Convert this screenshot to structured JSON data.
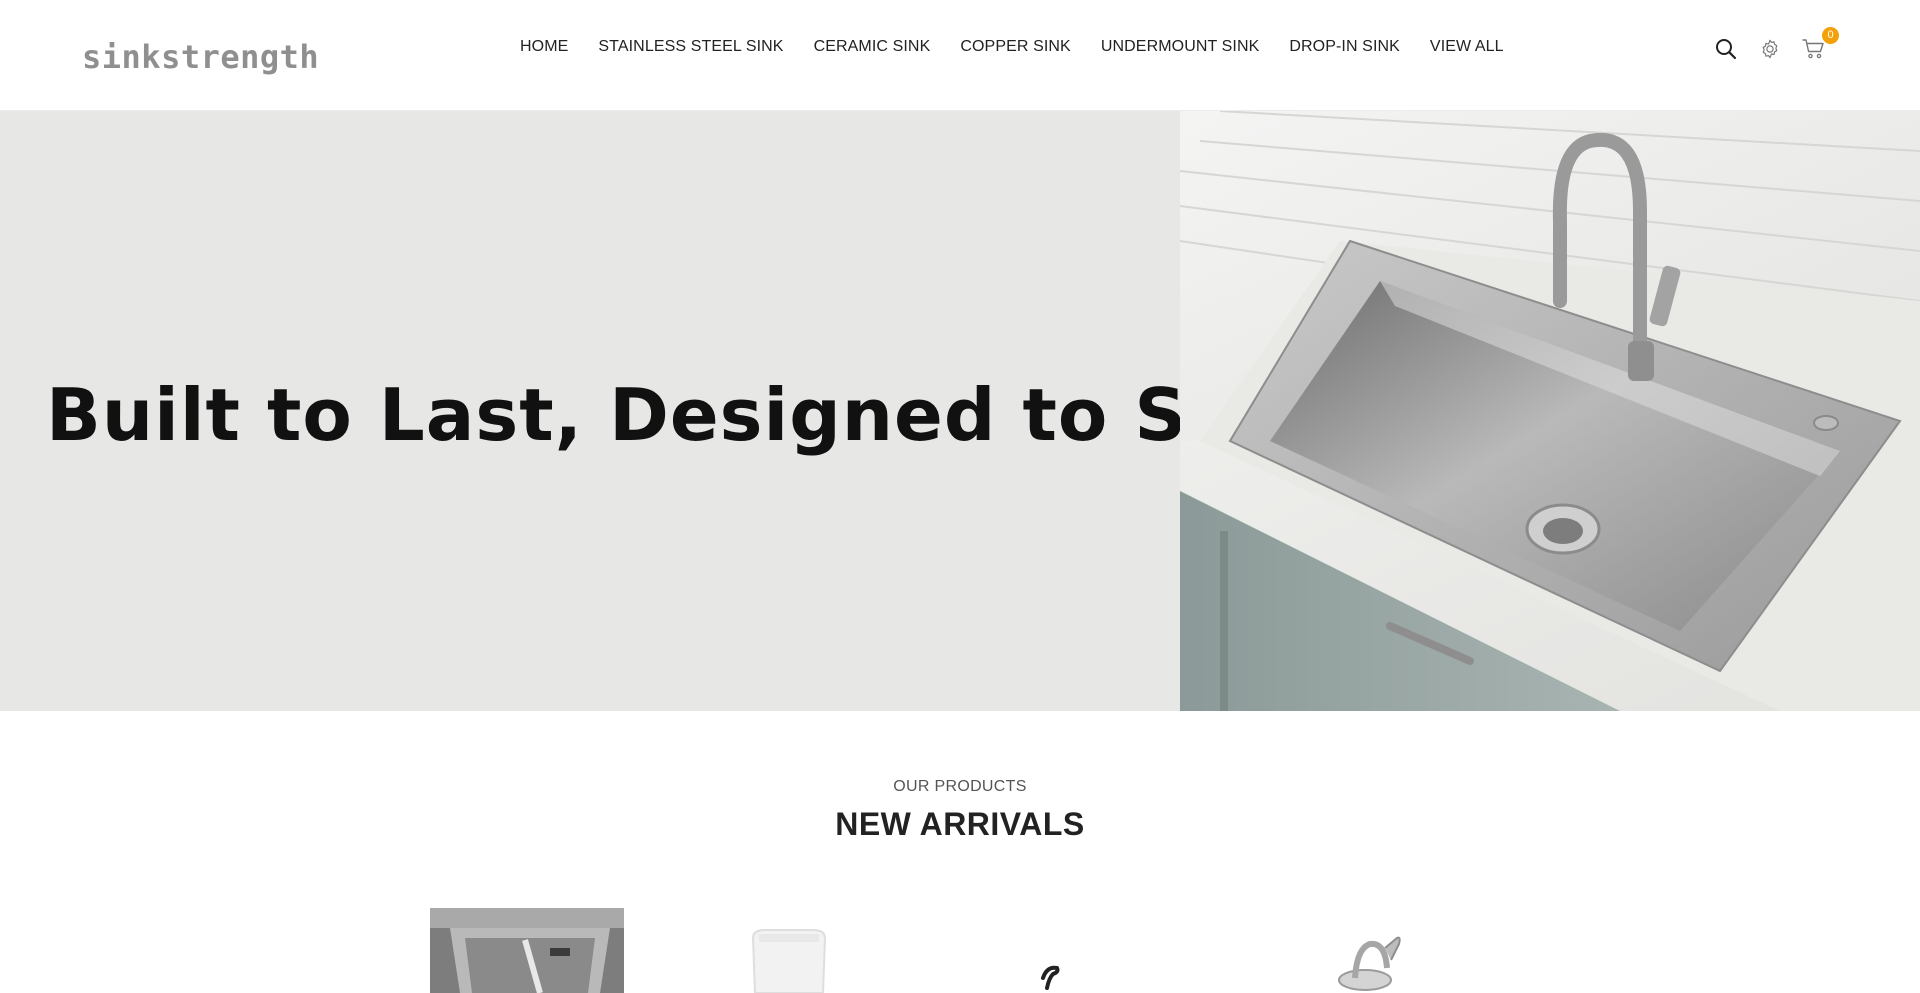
{
  "brand": {
    "logo_text": "sinkstrength"
  },
  "nav": {
    "items": [
      {
        "label": "HOME"
      },
      {
        "label": "STAINLESS STEEL SINK"
      },
      {
        "label": "CERAMIC SINK"
      },
      {
        "label": "COPPER SINK"
      },
      {
        "label": "UNDERMOUNT SINK"
      },
      {
        "label": "DROP-IN SINK"
      },
      {
        "label": "VIEW ALL"
      }
    ]
  },
  "header_icons": {
    "search": "search-icon",
    "settings": "gear-icon",
    "cart": "cart-icon",
    "cart_count": "0",
    "badge_color": "#f2a10b"
  },
  "hero": {
    "title": "Built to Last, Designed to Shine.",
    "background_color": "#e7e7e6"
  },
  "products_section": {
    "eyebrow": "OUR PRODUCTS",
    "title": "NEW ARRIVALS"
  }
}
